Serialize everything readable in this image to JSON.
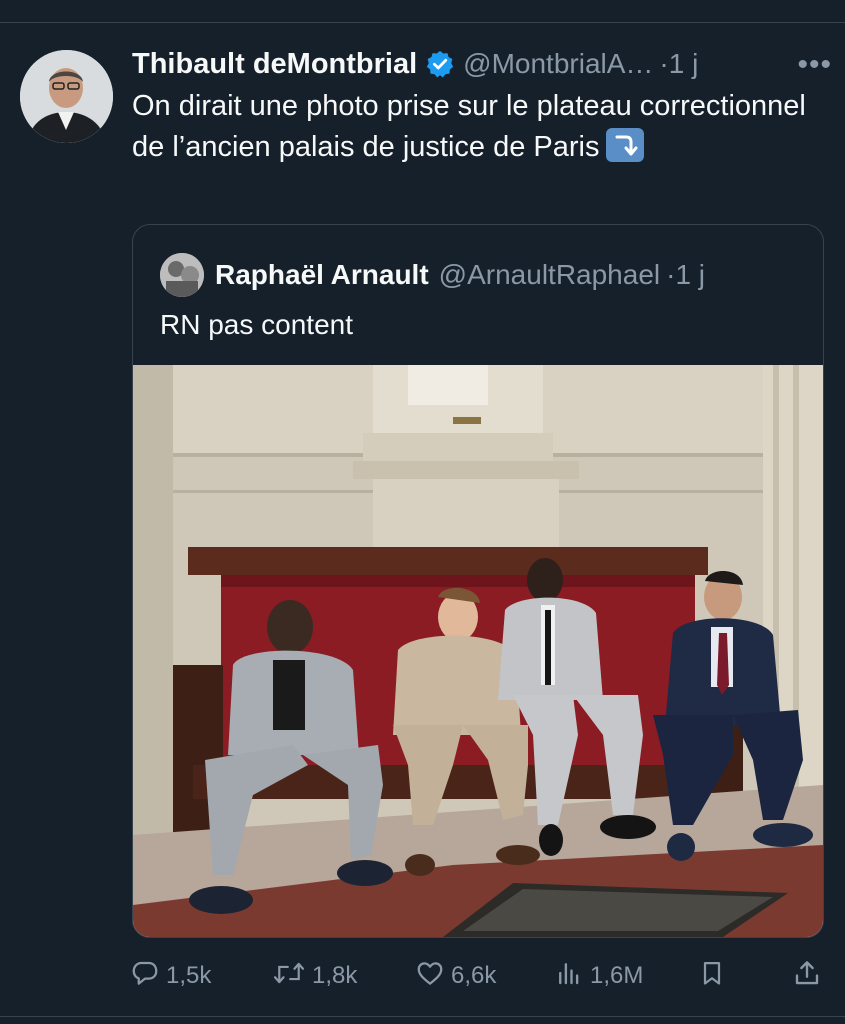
{
  "tweet": {
    "author_name": "Thibault deMontbrial",
    "handle": "@MontbrialA…",
    "separator": "·",
    "time": "1 j",
    "more_label": "•••",
    "text": "On dirait une photo prise sur le plateau correctionnel de l’ancien palais de justice de Paris"
  },
  "quote": {
    "author_name": "Raphaël Arnault",
    "handle": "@ArnaultRaphael",
    "separator": "·",
    "time": "1 j",
    "text": "RN pas content"
  },
  "actions": {
    "replies": "1,5k",
    "retweets": "1,8k",
    "likes": "6,6k",
    "views": "1,6M"
  },
  "icons": {
    "verified": "verified-badge-icon",
    "reply": "reply-icon",
    "retweet": "retweet-icon",
    "like": "heart-icon",
    "views": "views-icon",
    "bookmark": "bookmark-icon",
    "share": "share-icon",
    "emoji": "arrow-down-emoji-icon"
  },
  "colors": {
    "background": "#15202b",
    "text_primary": "#f7f9f9",
    "text_secondary": "#8b98a5",
    "verified": "#1d9bf0",
    "border": "#38444d"
  }
}
